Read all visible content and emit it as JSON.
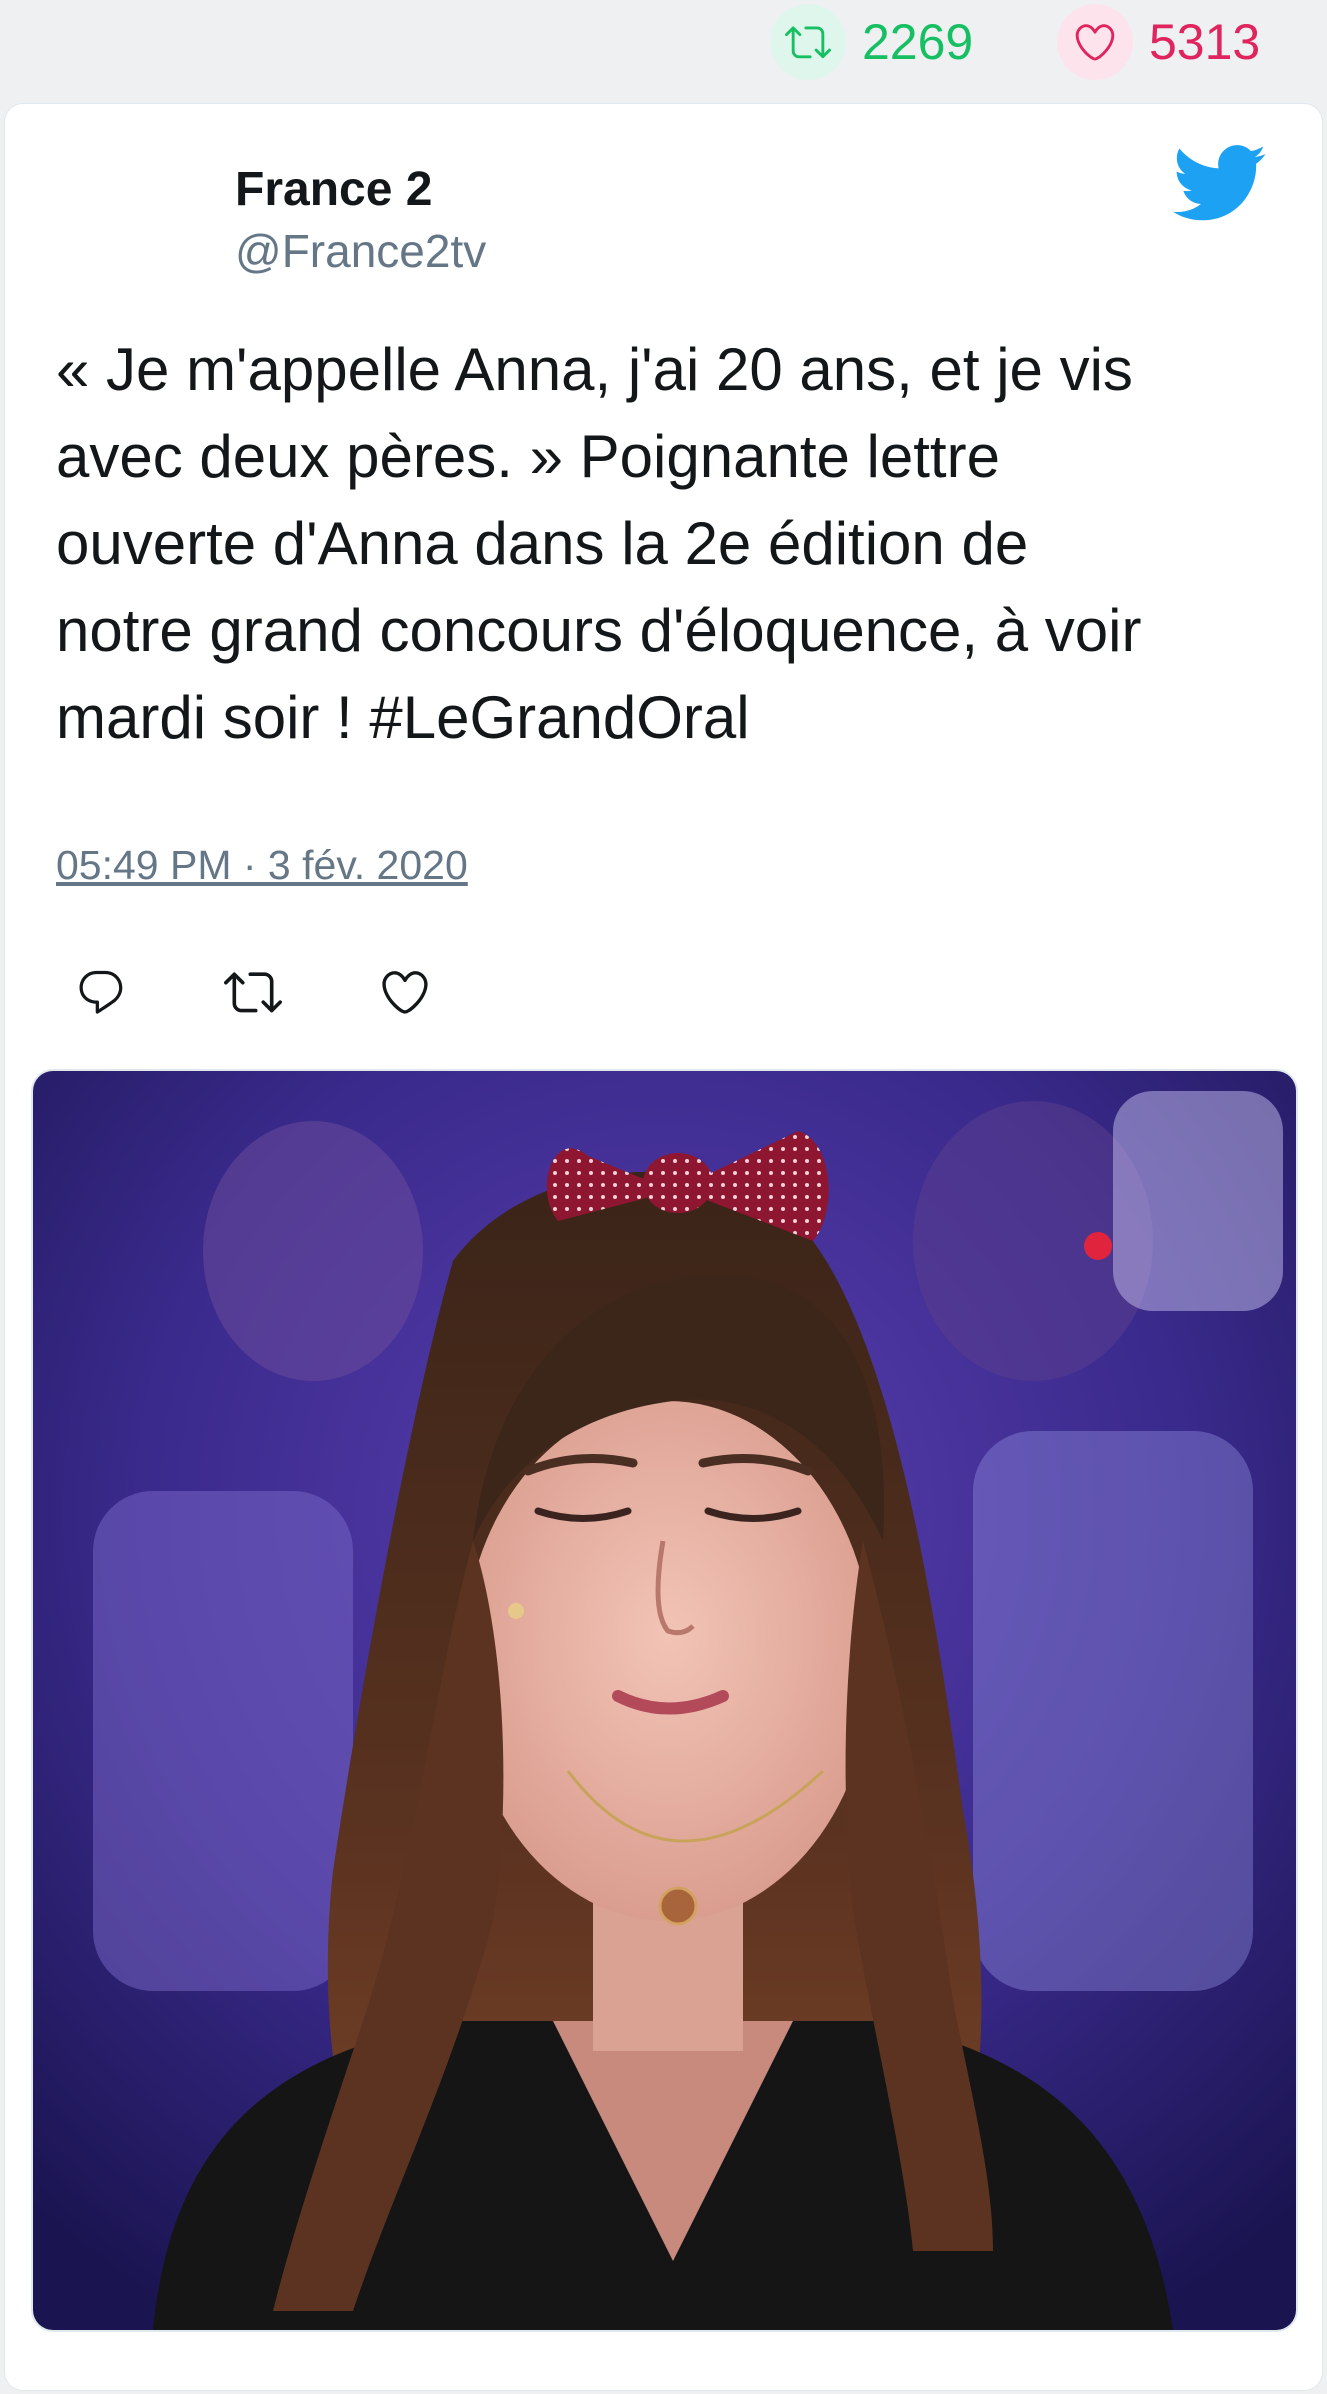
{
  "stats": {
    "retweet_count": "2269",
    "like_count": "5313",
    "retweet_icon": "retweet-icon",
    "like_icon": "heart-icon",
    "retweet_color": "#17bf63",
    "like_color": "#e0245e"
  },
  "tweet": {
    "author_name": "France 2",
    "author_handle": "@France2tv",
    "text": "« Je m'appelle Anna, j'ai 20 ans, et je vis\navec deux pères. » Poignante lettre\nouverte d'Anna dans la 2e édition de\nnotre grand concours d'éloquence, à voir\nmardi soir ! #LeGrandOral",
    "timestamp": "05:49 PM · 3 fév. 2020",
    "brand_icon": "twitter-bird-icon",
    "brand_color": "#1da1f2"
  },
  "actions": [
    {
      "name": "reply",
      "icon": "reply-icon"
    },
    {
      "name": "retweet",
      "icon": "retweet-icon"
    },
    {
      "name": "like",
      "icon": "heart-icon"
    }
  ],
  "media": {
    "type": "photo"
  }
}
